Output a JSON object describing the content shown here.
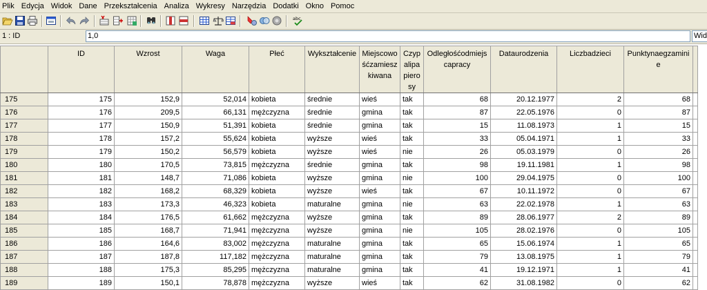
{
  "menu": [
    "Plik",
    "Edycja",
    "Widok",
    "Dane",
    "Przekształcenia",
    "Analiza",
    "Wykresy",
    "Narzędzia",
    "Dodatki",
    "Okno",
    "Pomoc"
  ],
  "toolbar": {
    "icons": [
      "open-folder-icon",
      "save-icon",
      "print-icon",
      "dialog-recall-icon",
      "undo-icon",
      "redo-icon",
      "goto-case-icon",
      "variables-icon",
      "find-icon",
      "insert-cases-icon",
      "insert-variable-icon",
      "split-file-icon",
      "weight-cases-icon",
      "select-cases-icon",
      "value-labels-icon",
      "use-sets-icon",
      "show-all-variables-icon",
      "spell-check-icon"
    ]
  },
  "editbar": {
    "cell_ref": "1 : ID",
    "cell_value": "1,0",
    "right_box": "Widoc"
  },
  "grid": {
    "columns": [
      "ID",
      "Wzrost",
      "Waga",
      "Płeć",
      "Wykształcenie",
      "Miejscowośćzamieszkiwana",
      "Czypalipapierosy",
      "Odległośćodmiejscapracy",
      "Dataurodzenia",
      "Liczbadzieci",
      "Punktynaegzaminie"
    ],
    "rows": [
      {
        "n": "175",
        "c": [
          "175",
          "152,9",
          "52,014",
          "kobieta",
          "średnie",
          "wieś",
          "tak",
          "68",
          "20.12.1977",
          "2",
          "68"
        ]
      },
      {
        "n": "176",
        "c": [
          "176",
          "209,5",
          "66,131",
          "mężczyzna",
          "średnie",
          "gmina",
          "tak",
          "87",
          "22.05.1976",
          "0",
          "87"
        ]
      },
      {
        "n": "177",
        "c": [
          "177",
          "150,9",
          "51,391",
          "kobieta",
          "średnie",
          "gmina",
          "tak",
          "15",
          "11.08.1973",
          "1",
          "15"
        ]
      },
      {
        "n": "178",
        "c": [
          "178",
          "157,2",
          "55,624",
          "kobieta",
          "wyższe",
          "wieś",
          "tak",
          "33",
          "05.04.1971",
          "1",
          "33"
        ]
      },
      {
        "n": "179",
        "c": [
          "179",
          "150,2",
          "56,579",
          "kobieta",
          "wyższe",
          "wieś",
          "nie",
          "26",
          "05.03.1979",
          "0",
          "26"
        ]
      },
      {
        "n": "180",
        "c": [
          "180",
          "170,5",
          "73,815",
          "mężczyzna",
          "średnie",
          "gmina",
          "tak",
          "98",
          "19.11.1981",
          "1",
          "98"
        ]
      },
      {
        "n": "181",
        "c": [
          "181",
          "148,7",
          "71,086",
          "kobieta",
          "wyższe",
          "gmina",
          "nie",
          "100",
          "29.04.1975",
          "0",
          "100"
        ]
      },
      {
        "n": "182",
        "c": [
          "182",
          "168,2",
          "68,329",
          "kobieta",
          "wyższe",
          "wieś",
          "tak",
          "67",
          "10.11.1972",
          "0",
          "67"
        ]
      },
      {
        "n": "183",
        "c": [
          "183",
          "173,3",
          "46,323",
          "kobieta",
          "maturalne",
          "gmina",
          "nie",
          "63",
          "22.02.1978",
          "1",
          "63"
        ]
      },
      {
        "n": "184",
        "c": [
          "184",
          "176,5",
          "61,662",
          "mężczyzna",
          "wyższe",
          "gmina",
          "tak",
          "89",
          "28.06.1977",
          "2",
          "89"
        ]
      },
      {
        "n": "185",
        "c": [
          "185",
          "168,7",
          "71,941",
          "mężczyzna",
          "wyższe",
          "gmina",
          "nie",
          "105",
          "28.02.1976",
          "0",
          "105"
        ]
      },
      {
        "n": "186",
        "c": [
          "186",
          "164,6",
          "83,002",
          "mężczyzna",
          "maturalne",
          "gmina",
          "tak",
          "65",
          "15.06.1974",
          "1",
          "65"
        ]
      },
      {
        "n": "187",
        "c": [
          "187",
          "187,8",
          "117,182",
          "mężczyzna",
          "maturalne",
          "gmina",
          "tak",
          "79",
          "13.08.1975",
          "1",
          "79"
        ]
      },
      {
        "n": "188",
        "c": [
          "188",
          "175,3",
          "85,295",
          "mężczyzna",
          "maturalne",
          "gmina",
          "tak",
          "41",
          "19.12.1971",
          "1",
          "41"
        ]
      },
      {
        "n": "189",
        "c": [
          "189",
          "150,1",
          "78,878",
          "mężczyzna",
          "wyższe",
          "wieś",
          "tak",
          "62",
          "31.08.1982",
          "0",
          "62"
        ]
      }
    ]
  }
}
